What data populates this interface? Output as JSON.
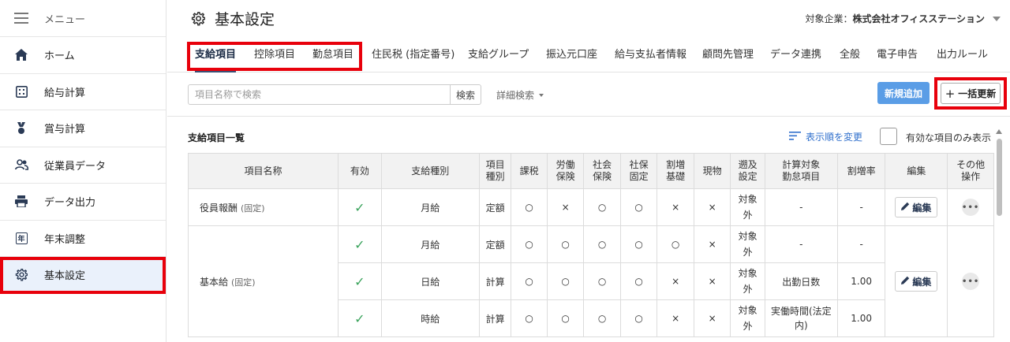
{
  "sidebar": {
    "menu_label": "メニュー",
    "items": [
      {
        "label": "ホーム",
        "icon": "home-icon"
      },
      {
        "label": "給与計算",
        "icon": "calculator-icon"
      },
      {
        "label": "賞与計算",
        "icon": "medal-icon"
      },
      {
        "label": "従業員データ",
        "icon": "people-icon"
      },
      {
        "label": "データ出力",
        "icon": "printer-icon"
      },
      {
        "label": "年末調整",
        "icon": "year-icon"
      },
      {
        "label": "基本設定",
        "icon": "gear-icon",
        "active": true
      }
    ],
    "year_glyph": "年"
  },
  "header": {
    "title": "基本設定",
    "company_label": "対象企業：",
    "company_name": "株式会社オフィスステーション"
  },
  "tabs": [
    {
      "label": "支給項目",
      "active": true
    },
    {
      "label": "控除項目"
    },
    {
      "label": "勤怠項目"
    },
    {
      "label": "住民税 (指定番号)"
    },
    {
      "label": "支給グループ"
    },
    {
      "label": "振込元口座"
    },
    {
      "label": "給与支払者情報"
    },
    {
      "label": "顧問先管理"
    },
    {
      "label": "データ連携"
    },
    {
      "label": "全般"
    },
    {
      "label": "電子申告"
    },
    {
      "label": "出力ルール"
    }
  ],
  "toolbar": {
    "search_placeholder": "項目名称で検索",
    "search_button": "検索",
    "advanced_search": "詳細検索",
    "new_button": "新規追加",
    "bulk_update_button": "一括更新"
  },
  "list": {
    "title": "支給項目一覧",
    "reorder_label": "表示順を変更",
    "active_only_label": "有効な項目のみ表示"
  },
  "table": {
    "headers": [
      "項目名称",
      "有効",
      "支給種別",
      "項目種別",
      "課税",
      "労働保険",
      "社会保険",
      "社保固定",
      "割増基礎",
      "現物",
      "遡及設定",
      "計算対象勤怠項目",
      "割増率",
      "編集",
      "その他操作"
    ],
    "header_lines": [
      [
        "項目名称"
      ],
      [
        "有効"
      ],
      [
        "支給種別"
      ],
      [
        "項目",
        "種別"
      ],
      [
        "課税"
      ],
      [
        "労働",
        "保険"
      ],
      [
        "社会",
        "保険"
      ],
      [
        "社保",
        "固定"
      ],
      [
        "割増",
        "基礎"
      ],
      [
        "現物"
      ],
      [
        "遡及",
        "設定"
      ],
      [
        "計算対象",
        "勤怠項目"
      ],
      [
        "割増率"
      ],
      [
        "編集"
      ],
      [
        "その他",
        "操作"
      ]
    ],
    "fixed_label": "(固定)",
    "edit_label": "編集",
    "rows": [
      {
        "name": "役員報酬",
        "fixed": true,
        "active": "✓",
        "pay_type": "月給",
        "item_type": "定額",
        "tax": "○",
        "labor": "×",
        "social": "○",
        "social_fixed": "○",
        "premium_base": "×",
        "in_kind": "×",
        "retro": "対象外",
        "attendance": "-",
        "rate": "-"
      },
      {
        "name": "基本給",
        "fixed": true,
        "active": "✓",
        "pay_type": "月給",
        "item_type": "定額",
        "tax": "○",
        "labor": "○",
        "social": "○",
        "social_fixed": "○",
        "premium_base": "○",
        "in_kind": "×",
        "retro": "対象外",
        "attendance": "-",
        "rate": "-"
      },
      {
        "name": "",
        "active": "✓",
        "pay_type": "日給",
        "item_type": "計算",
        "tax": "○",
        "labor": "○",
        "social": "○",
        "social_fixed": "○",
        "premium_base": "×",
        "in_kind": "×",
        "retro": "対象外",
        "attendance": "出勤日数",
        "rate": "1.00"
      },
      {
        "name": "",
        "active": "✓",
        "pay_type": "時給",
        "item_type": "計算",
        "tax": "○",
        "labor": "○",
        "social": "○",
        "social_fixed": "○",
        "premium_base": "×",
        "in_kind": "×",
        "retro": "対象外",
        "attendance": "実働時間(法定内)",
        "rate": "1.00"
      }
    ]
  },
  "colors": {
    "highlight_red": "#e8000b",
    "accent_blue": "#5a9de6",
    "link_blue": "#2f6fcc",
    "check_green": "#3aa35c"
  }
}
